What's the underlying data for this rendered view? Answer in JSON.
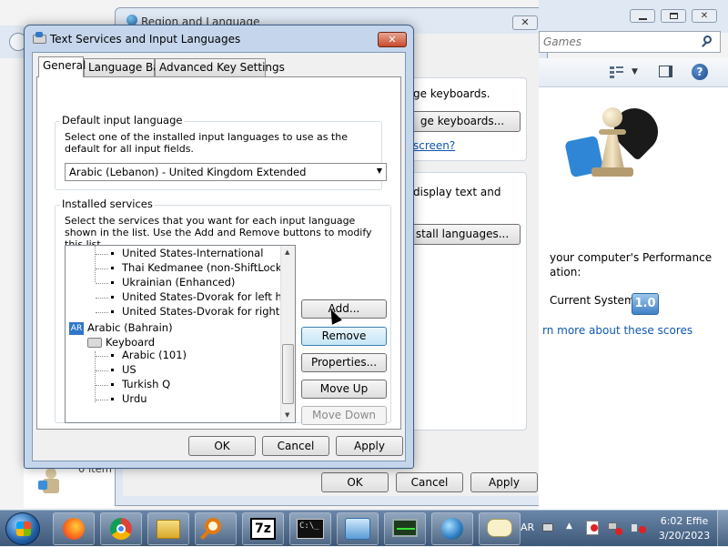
{
  "background_window": {
    "title": "Region and Language",
    "close_label": "✕",
    "keyboards_text": "ge keyboards.",
    "keyboards_button": "ge keyboards...",
    "screen_link": "screen?",
    "display_text_1": "display text and",
    "install_button": "stall languages...",
    "ok_label": "OK",
    "cancel_label": "Cancel",
    "apply_label": "Apply",
    "items_text": "0 item"
  },
  "games_window": {
    "search_placeholder": "Games",
    "perf_text_1": "your computer's Performance",
    "perf_text_2": "ation:",
    "current_system_label": "Current System",
    "score": "1.0",
    "scores_link": "rn more about these scores"
  },
  "dialog": {
    "title": "Text Services and Input Languages",
    "close_label": "✕",
    "tabs": [
      {
        "label": "General",
        "active": true
      },
      {
        "label": "Language Bar",
        "active": false
      },
      {
        "label": "Advanced Key Settings",
        "active": false
      }
    ],
    "default_input": {
      "legend": "Default input language",
      "description": "Select one of the installed input languages to use as the default for all input fields.",
      "selected": "Arabic (Lebanon) - United Kingdom Extended"
    },
    "installed_services": {
      "legend": "Installed services",
      "description": "Select the services that you want for each input language shown in the list. Use the Add and Remove buttons to modify this list.",
      "tree_items": [
        "United States-International",
        "Thai Kedmanee (non-ShiftLock)",
        "Ukrainian (Enhanced)",
        "United States-Dvorak for left hand",
        "United States-Dvorak for right hand"
      ],
      "language_badge": "AR",
      "language_name": "Arabic (Bahrain)",
      "keyboard_label": "Keyboard",
      "keyboard_items": [
        "Arabic (101)",
        "US",
        "Turkish Q",
        "Urdu"
      ]
    },
    "buttons": {
      "add": "Add...",
      "remove": "Remove",
      "properties": "Properties...",
      "move_up": "Move Up",
      "move_down": "Move Down"
    },
    "ok_label": "OK",
    "cancel_label": "Cancel",
    "apply_label": "Apply"
  },
  "taskbar": {
    "language_indicator": "AR",
    "time": "6:02 Effie",
    "date": "3/20/2023",
    "apps": [
      "firefox-icon",
      "chrome-icon",
      "file-explorer-icon",
      "search-magnifier-icon",
      "7zip-icon",
      "command-prompt-icon",
      "control-panel-icon",
      "network-monitor-icon",
      "globe-icon",
      "language-bar-icon"
    ]
  }
}
